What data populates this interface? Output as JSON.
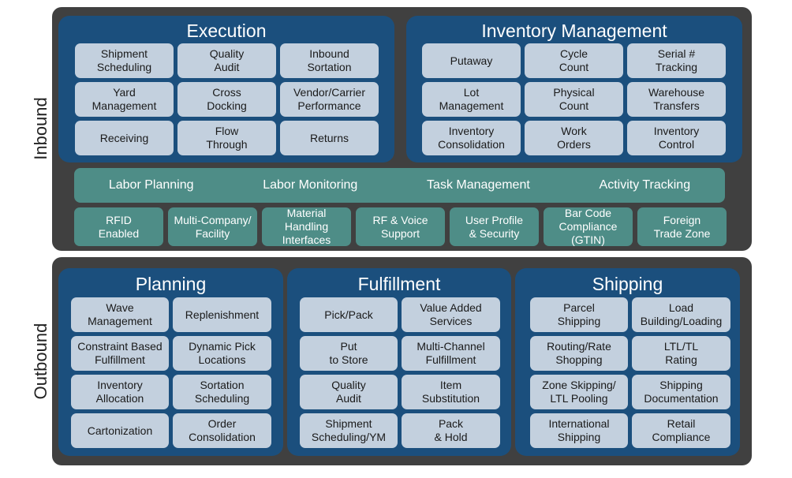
{
  "colors": {
    "band": "#404040",
    "panel": "#1b4f7d",
    "cell": "#c3d0de",
    "teal": "#4e8d87"
  },
  "inbound": {
    "label": "Inbound",
    "execution": {
      "title": "Execution",
      "items": [
        "Shipment\nScheduling",
        "Quality\nAudit",
        "Inbound\nSortation",
        "Yard\nManagement",
        "Cross\nDocking",
        "Vendor/Carrier\nPerformance",
        "Receiving",
        "Flow\nThrough",
        "Returns"
      ]
    },
    "inventory": {
      "title": "Inventory Management",
      "items": [
        "Putaway",
        "Cycle\nCount",
        "Serial #\nTracking",
        "Lot\nManagement",
        "Physical\nCount",
        "Warehouse\nTransfers",
        "Inventory\nConsolidation",
        "Work\nOrders",
        "Inventory\nControl"
      ]
    },
    "labor": [
      "Labor Planning",
      "Labor Monitoring",
      "Task Management",
      "Activity Tracking"
    ],
    "features": [
      "RFID\nEnabled",
      "Multi-Company/\nFacility",
      "Material\nHandling\nInterfaces",
      "RF & Voice\nSupport",
      "User Profile\n& Security",
      "Bar Code\nCompliance\n(GTIN)",
      "Foreign\nTrade Zone"
    ]
  },
  "outbound": {
    "label": "Outbound",
    "planning": {
      "title": "Planning",
      "items": [
        "Wave\nManagement",
        "Replenishment",
        "Constraint Based\nFulfillment",
        "Dynamic Pick\nLocations",
        "Inventory\nAllocation",
        "Sortation\nScheduling",
        "Cartonization",
        "Order\nConsolidation"
      ]
    },
    "fulfillment": {
      "title": "Fulfillment",
      "items": [
        "Pick/Pack",
        "Value Added\nServices",
        "Put\nto Store",
        "Multi-Channel\nFulfillment",
        "Quality\nAudit",
        "Item\nSubstitution",
        "Shipment\nScheduling/YM",
        "Pack\n& Hold"
      ]
    },
    "shipping": {
      "title": "Shipping",
      "items": [
        "Parcel\nShipping",
        "Load\nBuilding/Loading",
        "Routing/Rate\nShopping",
        "LTL/TL\nRating",
        "Zone Skipping/\nLTL Pooling",
        "Shipping\nDocumentation",
        "International\nShipping",
        "Retail\nCompliance"
      ]
    }
  }
}
